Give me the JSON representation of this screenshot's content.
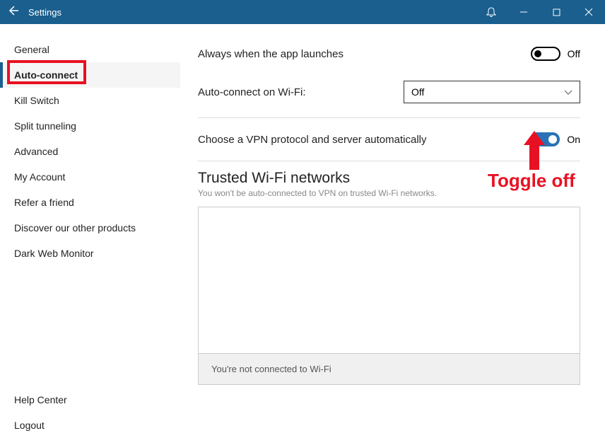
{
  "titlebar": {
    "title": "Settings"
  },
  "sidebar": {
    "items": [
      {
        "label": "General"
      },
      {
        "label": "Auto-connect"
      },
      {
        "label": "Kill Switch"
      },
      {
        "label": "Split tunneling"
      },
      {
        "label": "Advanced"
      },
      {
        "label": "My Account"
      },
      {
        "label": "Refer a friend"
      },
      {
        "label": "Discover our other products"
      },
      {
        "label": "Dark Web Monitor"
      }
    ],
    "active_index": 1,
    "bottom": [
      {
        "label": "Help Center"
      },
      {
        "label": "Logout"
      }
    ]
  },
  "content": {
    "launch_row_label": "Always when the app launches",
    "launch_toggle_state": "Off",
    "wifi_row_label": "Auto-connect on Wi-Fi:",
    "wifi_select_value": "Off",
    "protocol_row_label": "Choose a VPN protocol and server automatically",
    "protocol_toggle_state": "On",
    "trusted_title": "Trusted Wi-Fi networks",
    "trusted_sub": "You won't be auto-connected to VPN on trusted Wi-Fi networks.",
    "trusted_foot": "You're not connected to Wi-Fi"
  },
  "annotations": {
    "toggle_text": "Toggle off"
  }
}
